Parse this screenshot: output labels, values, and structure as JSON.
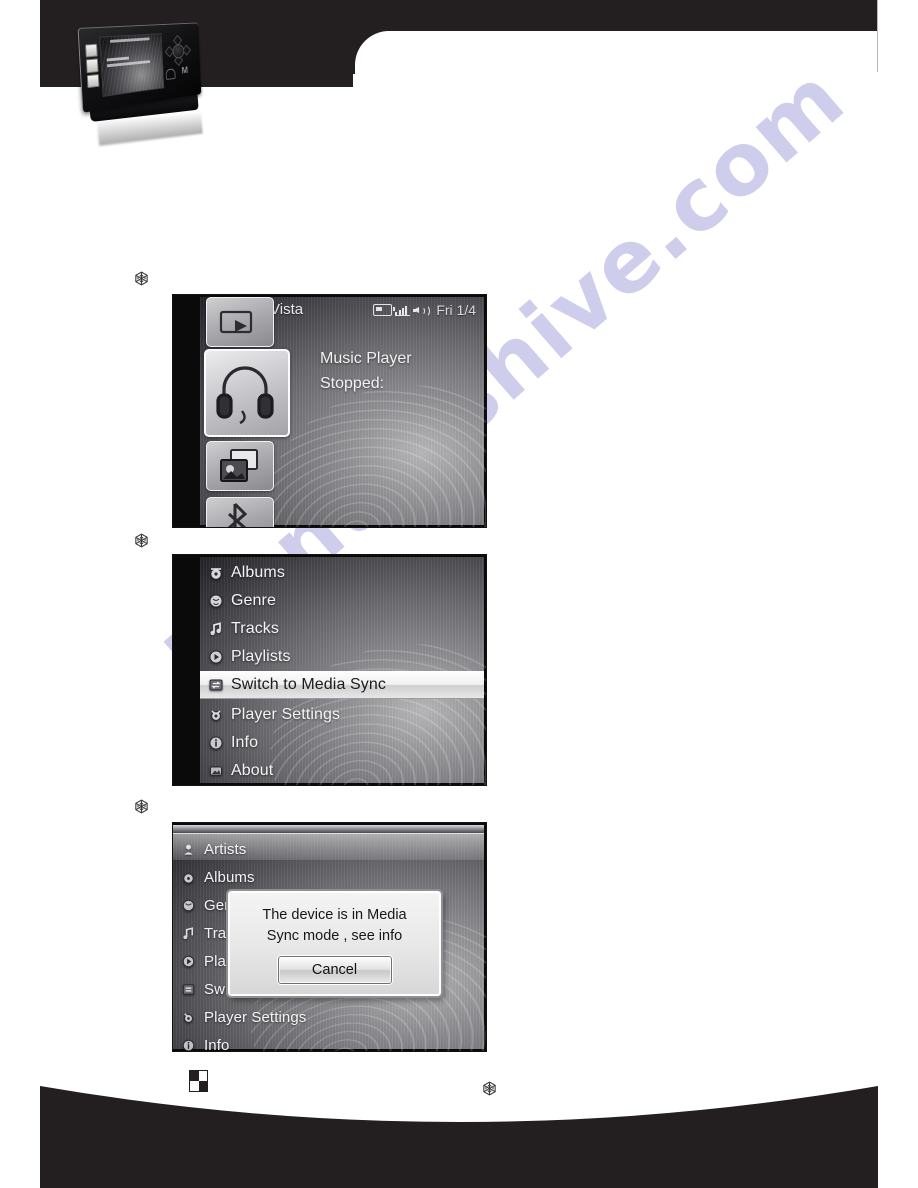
{
  "page": {
    "watermark": "manualshive.com",
    "bullet_icon": "snowflake-bullet-icon",
    "footer_icon": "checkerboard-icon",
    "footer_bullet_icon": "snowflake-bullet-icon"
  },
  "device_photo": {
    "name": "portable-media-player-photo",
    "button_m_label": "M"
  },
  "screenshots": [
    {
      "id": "shot1",
      "name": "now-playing-home-screen",
      "title": "KaneLu_Vista",
      "status": {
        "battery_icon": "battery-icon",
        "signal_icon": "signal-bars-icon",
        "speaker_icon": "speaker-volume-icon",
        "datetime": "Fri 1/4"
      },
      "tiles": [
        {
          "name": "tile-video",
          "icon": "video-tile-icon"
        },
        {
          "name": "tile-music-player",
          "icon": "headphones-icon",
          "selected": true
        },
        {
          "name": "tile-photos",
          "icon": "photo-gallery-icon"
        },
        {
          "name": "tile-bluetooth",
          "icon": "bluetooth-icon"
        }
      ],
      "body_line1": "Music Player",
      "body_line2": "Stopped:"
    },
    {
      "id": "shot2",
      "name": "music-library-menu",
      "items": [
        {
          "label": "Albums",
          "icon": "albums-icon",
          "selected": false
        },
        {
          "label": "Genre",
          "icon": "genre-icon",
          "selected": false
        },
        {
          "label": "Tracks",
          "icon": "tracks-icon",
          "selected": false
        },
        {
          "label": "Playlists",
          "icon": "playlists-icon",
          "selected": false
        },
        {
          "label": "Switch to Media Sync",
          "icon": "media-sync-icon",
          "selected": true
        },
        {
          "label": "Player Settings",
          "icon": "player-settings-icon",
          "selected": false
        },
        {
          "label": "Info",
          "icon": "info-icon",
          "selected": false
        },
        {
          "label": "About",
          "icon": "about-icon",
          "selected": false
        }
      ]
    },
    {
      "id": "shot3",
      "name": "media-sync-mode-dialog-screen",
      "items": [
        {
          "label": "Artists",
          "icon": "artists-icon",
          "selected": true
        },
        {
          "label": "Albums",
          "icon": "albums-icon",
          "selected": false
        },
        {
          "label": "Genre",
          "icon": "genre-icon",
          "selected": false
        },
        {
          "label": "Tracks",
          "icon": "tracks-icon",
          "selected": false
        },
        {
          "label": "Playlists",
          "icon": "playlists-icon",
          "selected": false
        },
        {
          "label": "Switch",
          "icon": "media-sync-icon",
          "selected": false
        },
        {
          "label": "Player Settings",
          "icon": "player-settings-icon",
          "selected": false
        },
        {
          "label": "Info",
          "icon": "info-icon",
          "selected": false
        }
      ],
      "dialog": {
        "name": "media-sync-alert-dialog",
        "message_line1": "The device is in Media",
        "message_line2": "Sync mode , see info",
        "cancel_label": "Cancel"
      }
    }
  ],
  "colors": {
    "header_black": "#231f20",
    "footer_black": "#231f20",
    "watermark": "#9a9ad8",
    "page_background": "#ffffff"
  }
}
